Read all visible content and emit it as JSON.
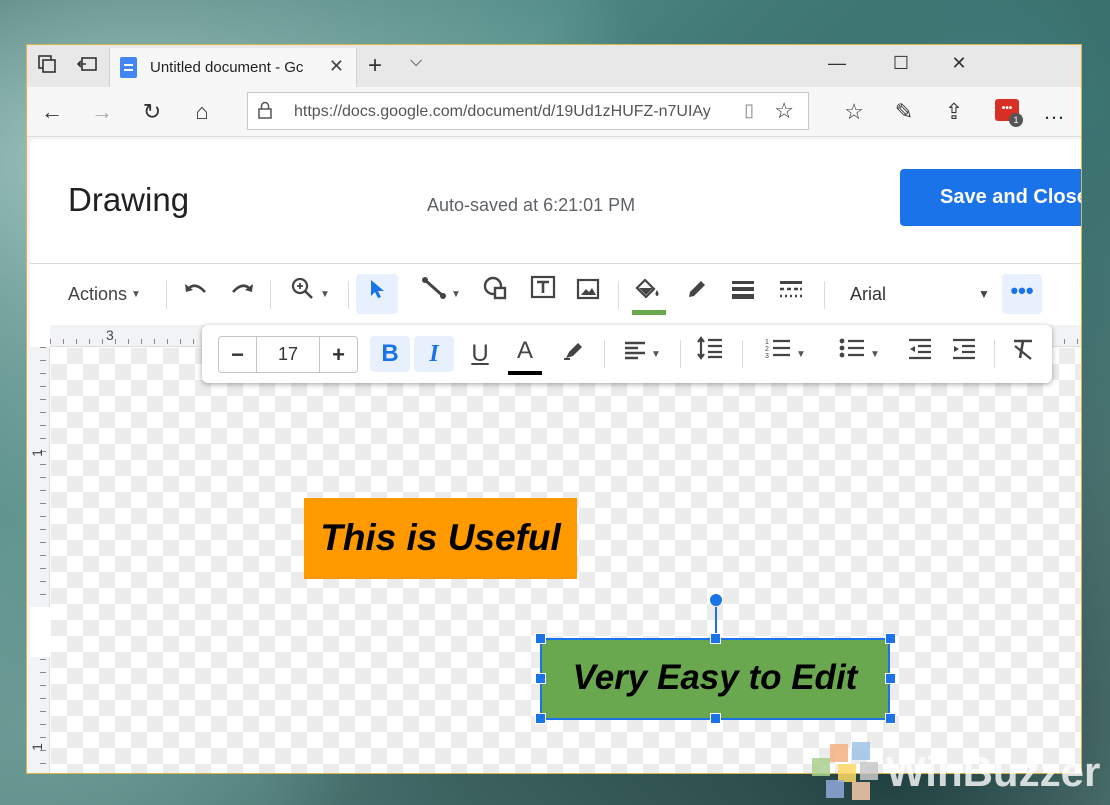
{
  "browser": {
    "tab_title": "Untitled document - Gc",
    "url": "https://docs.google.com/document/d/19Ud1zHUFZ-n7UIAy",
    "extension_badge": "•••",
    "extension_count": "1",
    "icons": {
      "tab_actions": "tab-actions-icon",
      "set_aside": "set-aside-tabs-icon",
      "new_tab": "+",
      "tab_list": "⌵",
      "minimize": "—",
      "maximize": "☐",
      "close": "✕",
      "back": "←",
      "forward": "→",
      "refresh": "↻",
      "home": "⌂",
      "lock": "🔒",
      "reader": "▯",
      "favorite": "☆",
      "favorites_bar": "☆",
      "pen": "✎",
      "share": "⇪",
      "more": "…"
    }
  },
  "dialog": {
    "title": "Drawing",
    "autosave": "Auto-saved at 6:21:01 PM",
    "save_label": "Save and Close"
  },
  "toolbar": {
    "actions_label": "Actions",
    "font_name": "Arial",
    "fill_color": "#6aa84f"
  },
  "ruler": {
    "top_mark": "3",
    "left_marks": [
      "1",
      "1"
    ]
  },
  "format": {
    "font_size": "17",
    "bold": true,
    "italic": true,
    "text_color": "#000000"
  },
  "shapes": [
    {
      "text": "This is Useful",
      "fill": "#ff9900"
    },
    {
      "text": "Very Easy to Edit",
      "fill": "#6aa84f",
      "selected": true
    }
  ],
  "watermark": {
    "text": "WinBuzzer"
  }
}
